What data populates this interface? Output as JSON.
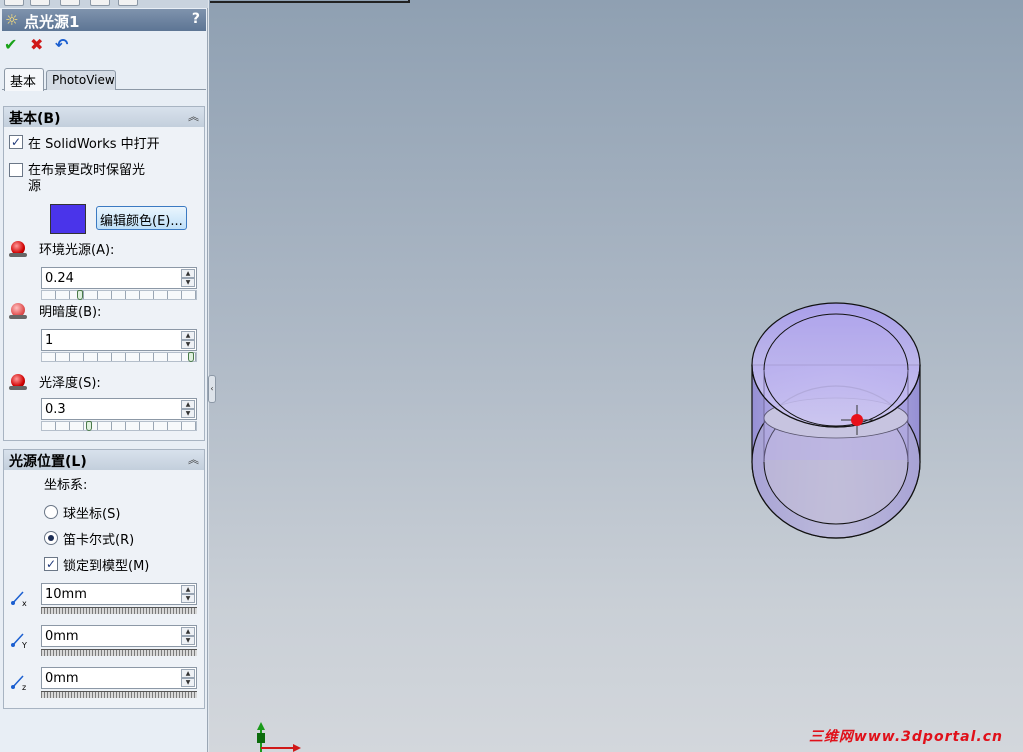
{
  "panel": {
    "title": "点光源1",
    "help": "?",
    "tabs": [
      "基本",
      "PhotoView"
    ],
    "basic_group": {
      "title": "基本(B)",
      "open_in_solidworks": {
        "label": "在 SolidWorks 中打开",
        "checked": true
      },
      "keep_on_scene_change": {
        "label_line1": "在布景更改时保留光",
        "label_line2": "源",
        "checked": false
      },
      "color": "#4a34ea",
      "edit_color_button": "编辑颜色(E)...",
      "ambient": {
        "label": "环境光源(A):",
        "value": "0.24",
        "slider_fraction": 0.24
      },
      "brightness": {
        "label": "明暗度(B):",
        "value": "1",
        "slider_fraction": 1.0
      },
      "specularity": {
        "label": "光泽度(S):",
        "value": "0.3",
        "slider_fraction": 0.3
      }
    },
    "position_group": {
      "title": "光源位置(L)",
      "coord_label": "坐标系:",
      "spherical": {
        "label": "球坐标(S)",
        "selected": false
      },
      "cartesian": {
        "label": "笛卡尔式(R)",
        "selected": true
      },
      "lock_to_model": {
        "label": "锁定到模型(M)",
        "checked": true
      },
      "x": {
        "axis": "x",
        "value": "10mm"
      },
      "y": {
        "axis": "Y",
        "value": "0mm"
      },
      "z": {
        "axis": "z",
        "value": "0mm"
      }
    }
  },
  "icons": {
    "ok": "checkmark-icon",
    "cancel": "cross-icon",
    "undo": "undo-icon",
    "collapse": "chevron-up-icon"
  },
  "watermark": "三维网www.3dportal.cn"
}
